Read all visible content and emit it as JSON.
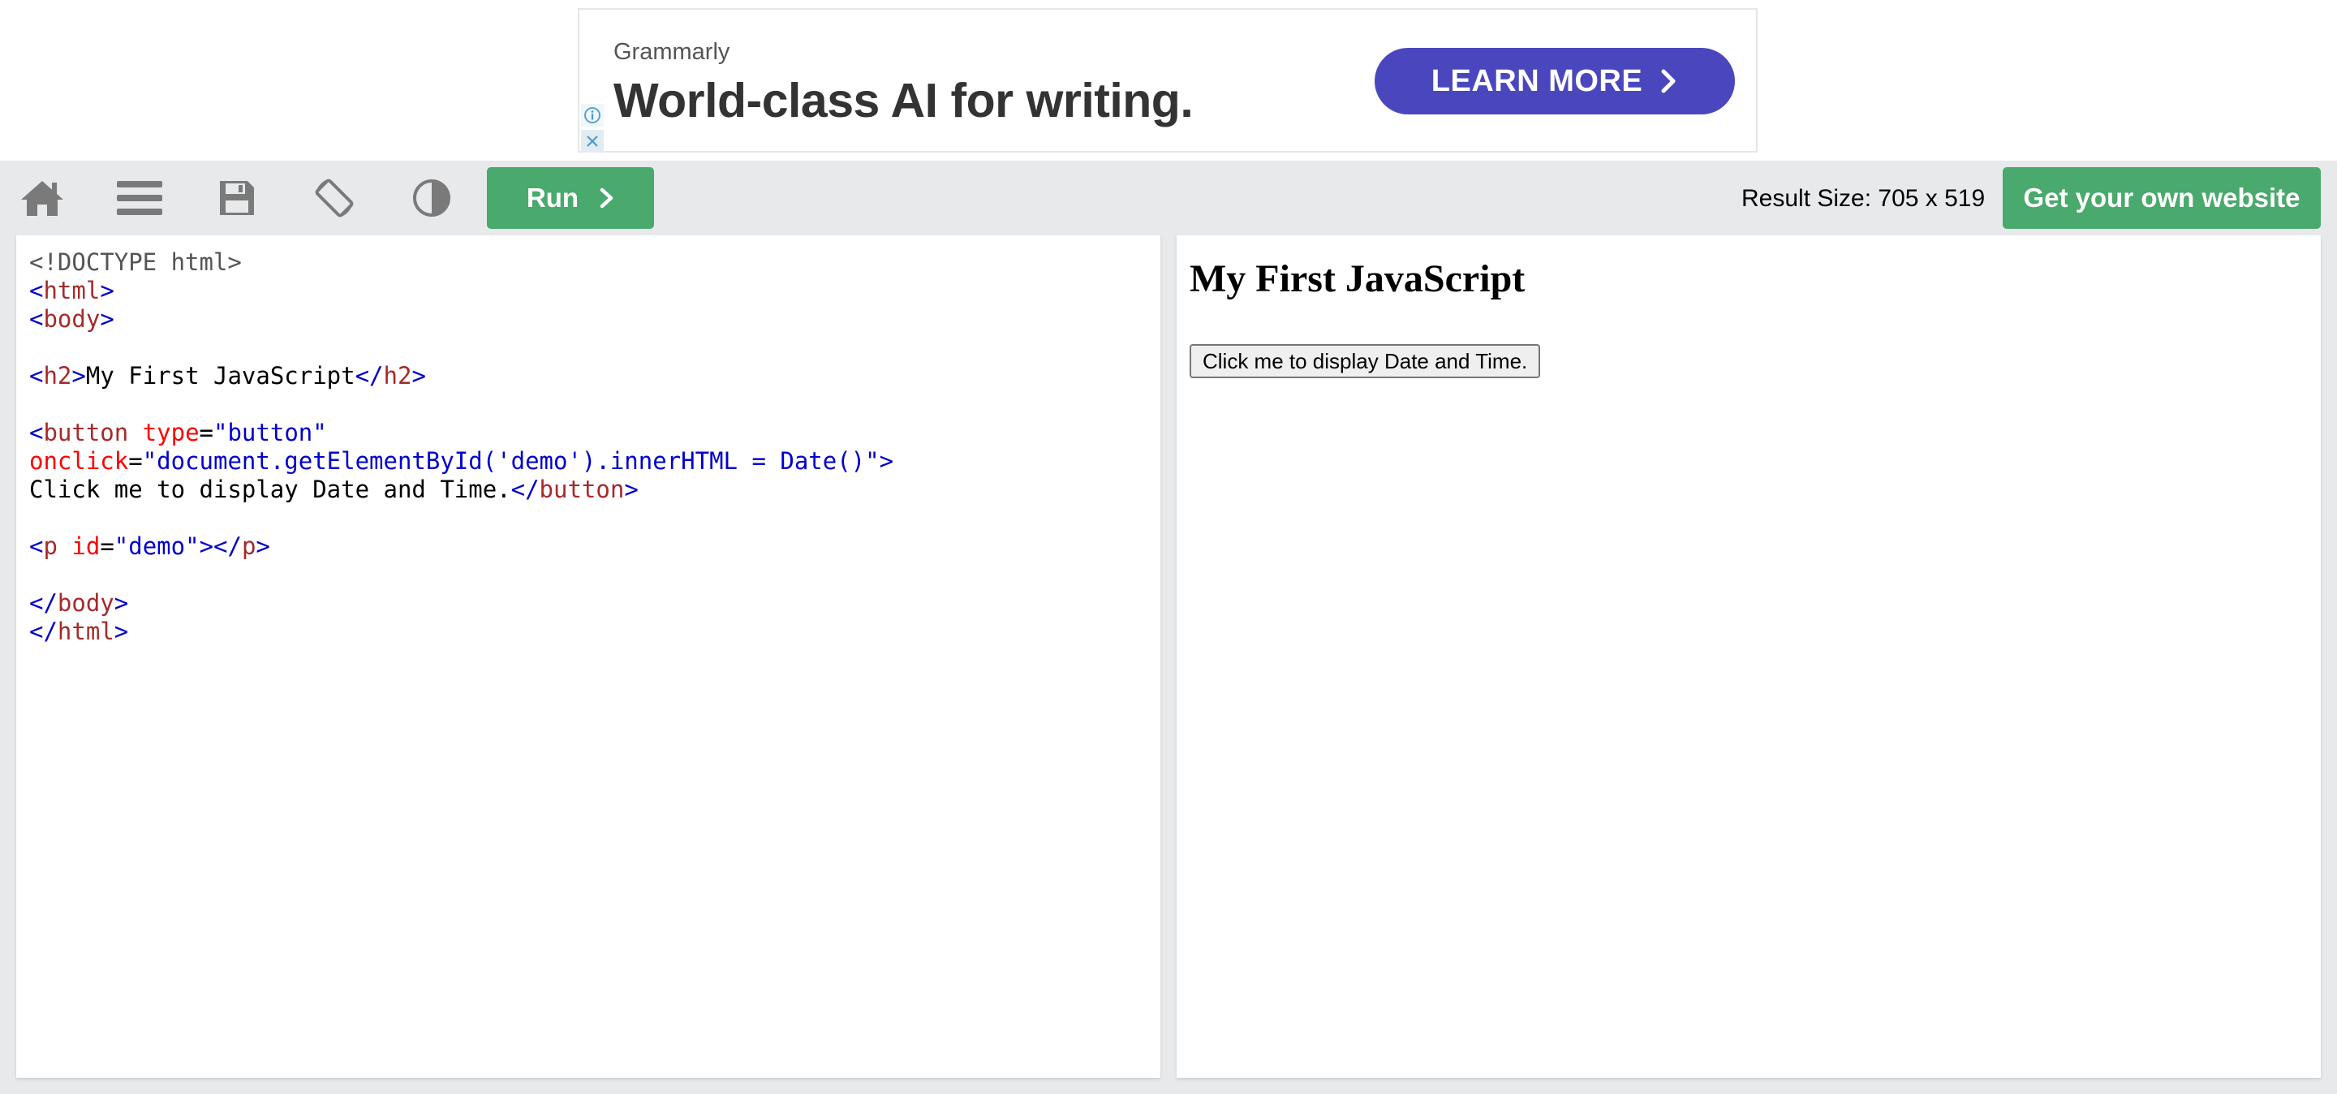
{
  "ad": {
    "brand": "Grammarly",
    "headline": "World-class AI for writing.",
    "cta_label": "LEARN MORE",
    "cta_color": "#4a47be",
    "info_icon": "info-icon",
    "close_icon": "close-icon"
  },
  "toolbar": {
    "icons": [
      "home-icon",
      "menu-icon",
      "save-icon",
      "rotate-icon",
      "contrast-icon"
    ],
    "run_label": "Run",
    "result_size": "Result Size: 705 x 519",
    "own_website_label": "Get your own website",
    "accent_color": "#4aa96c"
  },
  "editor": {
    "lines": [
      [
        {
          "t": "<!DOCTYPE html>",
          "c": "doctype"
        }
      ],
      [
        {
          "t": "<",
          "c": "bracket"
        },
        {
          "t": "html",
          "c": "tag"
        },
        {
          "t": ">",
          "c": "bracket"
        }
      ],
      [
        {
          "t": "<",
          "c": "bracket"
        },
        {
          "t": "body",
          "c": "tag"
        },
        {
          "t": ">",
          "c": "bracket"
        }
      ],
      [],
      [
        {
          "t": "<",
          "c": "bracket"
        },
        {
          "t": "h2",
          "c": "tag"
        },
        {
          "t": ">",
          "c": "bracket"
        },
        {
          "t": "My First JavaScript",
          "c": "text"
        },
        {
          "t": "</",
          "c": "bracket"
        },
        {
          "t": "h2",
          "c": "tag"
        },
        {
          "t": ">",
          "c": "bracket"
        }
      ],
      [],
      [
        {
          "t": "<",
          "c": "bracket"
        },
        {
          "t": "button",
          "c": "tag"
        },
        {
          "t": " ",
          "c": "text"
        },
        {
          "t": "type",
          "c": "attr"
        },
        {
          "t": "=",
          "c": "text"
        },
        {
          "t": "\"button\"",
          "c": "val"
        }
      ],
      [
        {
          "t": "onclick",
          "c": "attr"
        },
        {
          "t": "=",
          "c": "text"
        },
        {
          "t": "\"document.getElementById('demo').innerHTML = Date()\"",
          "c": "val"
        },
        {
          "t": ">",
          "c": "bracket"
        }
      ],
      [
        {
          "t": "Click me to display Date and Time.",
          "c": "text"
        },
        {
          "t": "</",
          "c": "bracket"
        },
        {
          "t": "button",
          "c": "tag"
        },
        {
          "t": ">",
          "c": "bracket"
        }
      ],
      [],
      [
        {
          "t": "<",
          "c": "bracket"
        },
        {
          "t": "p",
          "c": "tag"
        },
        {
          "t": " ",
          "c": "text"
        },
        {
          "t": "id",
          "c": "attr"
        },
        {
          "t": "=",
          "c": "text"
        },
        {
          "t": "\"demo\"",
          "c": "val"
        },
        {
          "t": "></",
          "c": "bracket"
        },
        {
          "t": "p",
          "c": "tag"
        },
        {
          "t": ">",
          "c": "bracket"
        }
      ],
      [],
      [
        {
          "t": "</",
          "c": "bracket"
        },
        {
          "t": "body",
          "c": "tag"
        },
        {
          "t": ">",
          "c": "bracket"
        }
      ],
      [
        {
          "t": "</",
          "c": "bracket"
        },
        {
          "t": "html",
          "c": "tag"
        },
        {
          "t": ">",
          "c": "bracket"
        }
      ]
    ]
  },
  "result": {
    "heading": "My First JavaScript",
    "button_label": "Click me to display Date and Time."
  }
}
